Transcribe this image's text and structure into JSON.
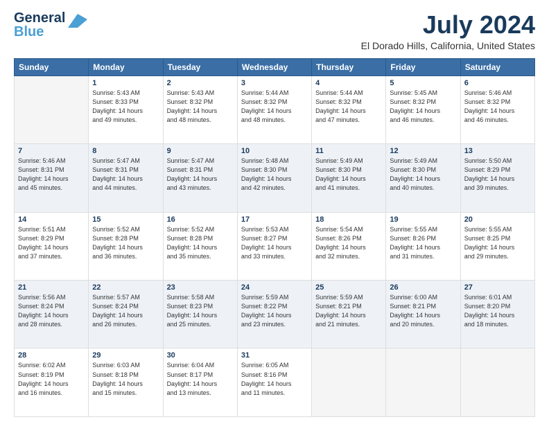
{
  "logo": {
    "line1": "General",
    "line2": "Blue"
  },
  "header": {
    "month_year": "July 2024",
    "location": "El Dorado Hills, California, United States"
  },
  "days_of_week": [
    "Sunday",
    "Monday",
    "Tuesday",
    "Wednesday",
    "Thursday",
    "Friday",
    "Saturday"
  ],
  "weeks": [
    [
      {
        "day": "",
        "info": ""
      },
      {
        "day": "1",
        "info": "Sunrise: 5:43 AM\nSunset: 8:33 PM\nDaylight: 14 hours\nand 49 minutes."
      },
      {
        "day": "2",
        "info": "Sunrise: 5:43 AM\nSunset: 8:32 PM\nDaylight: 14 hours\nand 48 minutes."
      },
      {
        "day": "3",
        "info": "Sunrise: 5:44 AM\nSunset: 8:32 PM\nDaylight: 14 hours\nand 48 minutes."
      },
      {
        "day": "4",
        "info": "Sunrise: 5:44 AM\nSunset: 8:32 PM\nDaylight: 14 hours\nand 47 minutes."
      },
      {
        "day": "5",
        "info": "Sunrise: 5:45 AM\nSunset: 8:32 PM\nDaylight: 14 hours\nand 46 minutes."
      },
      {
        "day": "6",
        "info": "Sunrise: 5:46 AM\nSunset: 8:32 PM\nDaylight: 14 hours\nand 46 minutes."
      }
    ],
    [
      {
        "day": "7",
        "info": "Sunrise: 5:46 AM\nSunset: 8:31 PM\nDaylight: 14 hours\nand 45 minutes."
      },
      {
        "day": "8",
        "info": "Sunrise: 5:47 AM\nSunset: 8:31 PM\nDaylight: 14 hours\nand 44 minutes."
      },
      {
        "day": "9",
        "info": "Sunrise: 5:47 AM\nSunset: 8:31 PM\nDaylight: 14 hours\nand 43 minutes."
      },
      {
        "day": "10",
        "info": "Sunrise: 5:48 AM\nSunset: 8:30 PM\nDaylight: 14 hours\nand 42 minutes."
      },
      {
        "day": "11",
        "info": "Sunrise: 5:49 AM\nSunset: 8:30 PM\nDaylight: 14 hours\nand 41 minutes."
      },
      {
        "day": "12",
        "info": "Sunrise: 5:49 AM\nSunset: 8:30 PM\nDaylight: 14 hours\nand 40 minutes."
      },
      {
        "day": "13",
        "info": "Sunrise: 5:50 AM\nSunset: 8:29 PM\nDaylight: 14 hours\nand 39 minutes."
      }
    ],
    [
      {
        "day": "14",
        "info": "Sunrise: 5:51 AM\nSunset: 8:29 PM\nDaylight: 14 hours\nand 37 minutes."
      },
      {
        "day": "15",
        "info": "Sunrise: 5:52 AM\nSunset: 8:28 PM\nDaylight: 14 hours\nand 36 minutes."
      },
      {
        "day": "16",
        "info": "Sunrise: 5:52 AM\nSunset: 8:28 PM\nDaylight: 14 hours\nand 35 minutes."
      },
      {
        "day": "17",
        "info": "Sunrise: 5:53 AM\nSunset: 8:27 PM\nDaylight: 14 hours\nand 33 minutes."
      },
      {
        "day": "18",
        "info": "Sunrise: 5:54 AM\nSunset: 8:26 PM\nDaylight: 14 hours\nand 32 minutes."
      },
      {
        "day": "19",
        "info": "Sunrise: 5:55 AM\nSunset: 8:26 PM\nDaylight: 14 hours\nand 31 minutes."
      },
      {
        "day": "20",
        "info": "Sunrise: 5:55 AM\nSunset: 8:25 PM\nDaylight: 14 hours\nand 29 minutes."
      }
    ],
    [
      {
        "day": "21",
        "info": "Sunrise: 5:56 AM\nSunset: 8:24 PM\nDaylight: 14 hours\nand 28 minutes."
      },
      {
        "day": "22",
        "info": "Sunrise: 5:57 AM\nSunset: 8:24 PM\nDaylight: 14 hours\nand 26 minutes."
      },
      {
        "day": "23",
        "info": "Sunrise: 5:58 AM\nSunset: 8:23 PM\nDaylight: 14 hours\nand 25 minutes."
      },
      {
        "day": "24",
        "info": "Sunrise: 5:59 AM\nSunset: 8:22 PM\nDaylight: 14 hours\nand 23 minutes."
      },
      {
        "day": "25",
        "info": "Sunrise: 5:59 AM\nSunset: 8:21 PM\nDaylight: 14 hours\nand 21 minutes."
      },
      {
        "day": "26",
        "info": "Sunrise: 6:00 AM\nSunset: 8:21 PM\nDaylight: 14 hours\nand 20 minutes."
      },
      {
        "day": "27",
        "info": "Sunrise: 6:01 AM\nSunset: 8:20 PM\nDaylight: 14 hours\nand 18 minutes."
      }
    ],
    [
      {
        "day": "28",
        "info": "Sunrise: 6:02 AM\nSunset: 8:19 PM\nDaylight: 14 hours\nand 16 minutes."
      },
      {
        "day": "29",
        "info": "Sunrise: 6:03 AM\nSunset: 8:18 PM\nDaylight: 14 hours\nand 15 minutes."
      },
      {
        "day": "30",
        "info": "Sunrise: 6:04 AM\nSunset: 8:17 PM\nDaylight: 14 hours\nand 13 minutes."
      },
      {
        "day": "31",
        "info": "Sunrise: 6:05 AM\nSunset: 8:16 PM\nDaylight: 14 hours\nand 11 minutes."
      },
      {
        "day": "",
        "info": ""
      },
      {
        "day": "",
        "info": ""
      },
      {
        "day": "",
        "info": ""
      }
    ]
  ]
}
